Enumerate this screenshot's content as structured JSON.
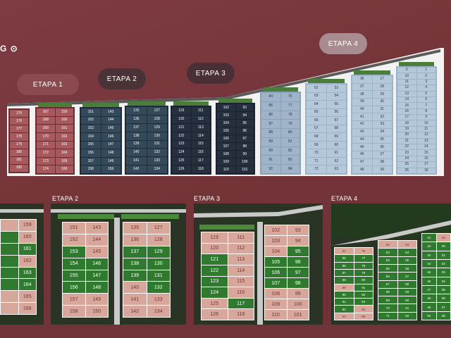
{
  "header": {
    "logo_text": "G ⊙"
  },
  "stage_buttons": [
    {
      "label": "ETAPA 1"
    },
    {
      "label": "ETAPA 2"
    },
    {
      "label": "ETAPA 3"
    },
    {
      "label": "ETAPA 4"
    }
  ],
  "master_plan": {
    "etapa1_left": [
      "175",
      "176",
      "177",
      "178",
      "179",
      "180",
      "181",
      "182"
    ],
    "etapa1_b": [
      [
        "167",
        "159"
      ],
      [
        "168",
        "160"
      ],
      [
        "169",
        "161"
      ],
      [
        "170",
        "162"
      ],
      [
        "171",
        "163"
      ],
      [
        "172",
        "164"
      ],
      [
        "173",
        "165"
      ],
      [
        "174",
        "166"
      ]
    ],
    "etapa2_a": [
      [
        "151",
        "143"
      ],
      [
        "152",
        "144"
      ],
      [
        "153",
        "145"
      ],
      [
        "154",
        "146"
      ],
      [
        "155",
        "147"
      ],
      [
        "156",
        "148"
      ],
      [
        "157",
        "149"
      ],
      [
        "158",
        "150"
      ]
    ],
    "etapa2_b": [
      [
        "135",
        "127"
      ],
      [
        "136",
        "128"
      ],
      [
        "137",
        "129"
      ],
      [
        "138",
        "130"
      ],
      [
        "139",
        "131"
      ],
      [
        "140",
        "132"
      ],
      [
        "141",
        "133"
      ],
      [
        "142",
        "134"
      ]
    ],
    "etapa3_a": [
      [
        "119",
        "111"
      ],
      [
        "120",
        "112"
      ],
      [
        "121",
        "113"
      ],
      [
        "122",
        "114"
      ],
      [
        "123",
        "115"
      ],
      [
        "124",
        "116"
      ],
      [
        "125",
        "117"
      ],
      [
        "126",
        "118"
      ]
    ],
    "etapa3_b": [
      [
        "102",
        "93"
      ],
      [
        "103",
        "94"
      ],
      [
        "104",
        "95"
      ],
      [
        "105",
        "96"
      ],
      [
        "106",
        "97"
      ],
      [
        "107",
        "98"
      ],
      [
        "108",
        "99"
      ],
      [
        "109",
        "100"
      ],
      [
        "110",
        "101"
      ]
    ],
    "etapa4_a": [
      [
        "84",
        "76"
      ],
      [
        "85",
        "77"
      ],
      [
        "86",
        "78"
      ],
      [
        "87",
        "79"
      ],
      [
        "88",
        "80"
      ],
      [
        "89",
        "81"
      ],
      [
        "90",
        "82"
      ],
      [
        "91",
        "83"
      ],
      [
        "92",
        "84"
      ]
    ],
    "etapa4_b": [
      [
        "62",
        "53"
      ],
      [
        "63",
        "54"
      ],
      [
        "64",
        "55"
      ],
      [
        "65",
        "56"
      ],
      [
        "66",
        "57"
      ],
      [
        "67",
        "58"
      ],
      [
        "68",
        "59"
      ],
      [
        "69",
        "60"
      ],
      [
        "70",
        "61"
      ],
      [
        "71",
        "62"
      ],
      [
        "72",
        "63"
      ]
    ],
    "etapa4_c": [
      [
        "36",
        "27"
      ],
      [
        "37",
        "28"
      ],
      [
        "38",
        "29"
      ],
      [
        "39",
        "30"
      ],
      [
        "40",
        "31"
      ],
      [
        "41",
        "32"
      ],
      [
        "42",
        "33"
      ],
      [
        "43",
        "34"
      ],
      [
        "44",
        "35"
      ],
      [
        "45",
        "36"
      ],
      [
        "46",
        "37"
      ],
      [
        "47",
        "38"
      ],
      [
        "48",
        "39"
      ]
    ],
    "etapa4_d": [
      [
        "9",
        "1"
      ],
      [
        "10",
        "2"
      ],
      [
        "11",
        "3"
      ],
      [
        "12",
        "4"
      ],
      [
        "13",
        "5"
      ],
      [
        "14",
        "6"
      ],
      [
        "15",
        "7"
      ],
      [
        "16",
        "8"
      ],
      [
        "17",
        "9"
      ],
      [
        "18",
        "10"
      ],
      [
        "19",
        "11"
      ],
      [
        "20",
        "12"
      ],
      [
        "21",
        "13"
      ],
      [
        "22",
        "14"
      ],
      [
        "23",
        "15"
      ],
      [
        "24",
        "16"
      ],
      [
        "25",
        "17"
      ],
      [
        "26",
        "18"
      ]
    ]
  },
  "panels": {
    "etapa1": {
      "label": "",
      "lots": [
        [
          "",
          "159"
        ],
        [
          "",
          "160"
        ],
        [
          "",
          "161"
        ],
        [
          "",
          "162"
        ],
        [
          "",
          "163"
        ],
        [
          "",
          "164"
        ],
        [
          "",
          "165"
        ],
        [
          "",
          "166"
        ]
      ],
      "status": [
        [
          "p",
          "p"
        ],
        [
          "g",
          "p"
        ],
        [
          "g",
          "g"
        ],
        [
          "g",
          "p"
        ],
        [
          "g",
          "g"
        ],
        [
          "g",
          "g"
        ],
        [
          "p",
          "p"
        ],
        [
          "p",
          "p"
        ]
      ]
    },
    "etapa2": {
      "label": "ETAPA 2",
      "lots_a": [
        [
          "151",
          "143"
        ],
        [
          "152",
          "144"
        ],
        [
          "153",
          "145"
        ],
        [
          "154",
          "146"
        ],
        [
          "155",
          "147"
        ],
        [
          "156",
          "148"
        ],
        [
          "157",
          "149"
        ],
        [
          "158",
          "150"
        ]
      ],
      "status_a": [
        [
          "p",
          "p"
        ],
        [
          "p",
          "p"
        ],
        [
          "g",
          "p"
        ],
        [
          "g",
          "g"
        ],
        [
          "g",
          "g"
        ],
        [
          "g",
          "g"
        ],
        [
          "p",
          "p"
        ],
        [
          "p",
          "p"
        ]
      ],
      "lots_b": [
        [
          "135",
          "127"
        ],
        [
          "136",
          "128"
        ],
        [
          "137",
          "129"
        ],
        [
          "138",
          "130"
        ],
        [
          "139",
          "131"
        ],
        [
          "140",
          "132"
        ],
        [
          "141",
          "133"
        ],
        [
          "142",
          "134"
        ]
      ],
      "status_b": [
        [
          "p",
          "p"
        ],
        [
          "p",
          "p"
        ],
        [
          "g",
          "g"
        ],
        [
          "g",
          "g"
        ],
        [
          "g",
          "g"
        ],
        [
          "p",
          "g"
        ],
        [
          "p",
          "p"
        ],
        [
          "p",
          "p"
        ]
      ]
    },
    "etapa3": {
      "label": "ETAPA 3",
      "lots_a": [
        [
          "119",
          "111"
        ],
        [
          "120",
          "112"
        ],
        [
          "121",
          "113"
        ],
        [
          "122",
          "114"
        ],
        [
          "123",
          "115"
        ],
        [
          "124",
          "116"
        ],
        [
          "125",
          "117"
        ],
        [
          "126",
          "118"
        ]
      ],
      "status_a": [
        [
          "p",
          "p"
        ],
        [
          "p",
          "p"
        ],
        [
          "g",
          "p"
        ],
        [
          "g",
          "p"
        ],
        [
          "g",
          "p"
        ],
        [
          "g",
          "p"
        ],
        [
          "p",
          "g"
        ],
        [
          "p",
          "p"
        ]
      ],
      "lots_b": [
        [
          "102",
          "93"
        ],
        [
          "103",
          "94"
        ],
        [
          "104",
          "95"
        ],
        [
          "105",
          "96"
        ],
        [
          "106",
          "97"
        ],
        [
          "107",
          "98"
        ],
        [
          "108",
          "99"
        ],
        [
          "109",
          "100"
        ],
        [
          "110",
          "101"
        ]
      ],
      "status_b": [
        [
          "p",
          "p"
        ],
        [
          "p",
          "p"
        ],
        [
          "p",
          "g"
        ],
        [
          "g",
          "g"
        ],
        [
          "g",
          "g"
        ],
        [
          "g",
          "g"
        ],
        [
          "p",
          "p"
        ],
        [
          "p",
          "p"
        ],
        [
          "p",
          "p"
        ]
      ]
    },
    "etapa4": {
      "label": "ETAPA 4",
      "lots_a": [
        [
          "84",
          "76"
        ],
        [
          "85",
          "77"
        ],
        [
          "86",
          "78"
        ],
        [
          "87",
          "79"
        ],
        [
          "88",
          "80"
        ],
        [
          "89",
          "81"
        ],
        [
          "90",
          "82"
        ],
        [
          "91",
          "83"
        ],
        [
          "92",
          "84"
        ],
        [
          "93",
          "85"
        ]
      ],
      "status_a": [
        [
          "p",
          "p"
        ],
        [
          "g",
          "g"
        ],
        [
          "g",
          "g"
        ],
        [
          "g",
          "g"
        ],
        [
          "g",
          "g"
        ],
        [
          "p",
          "g"
        ],
        [
          "g",
          "g"
        ],
        [
          "g",
          "g"
        ],
        [
          "g",
          "p"
        ],
        [
          "p",
          "p"
        ]
      ],
      "lots_b": [
        [
          "62",
          "53"
        ],
        [
          "63",
          "54"
        ],
        [
          "64",
          "55"
        ],
        [
          "65",
          "56"
        ],
        [
          "66",
          "57"
        ],
        [
          "67",
          "58"
        ],
        [
          "68",
          "59"
        ],
        [
          "69",
          "60"
        ],
        [
          "70",
          "61"
        ],
        [
          "71",
          "62"
        ]
      ],
      "status_b": [
        [
          "p",
          "p"
        ],
        [
          "g",
          "g"
        ],
        [
          "g",
          "g"
        ],
        [
          "g",
          "g"
        ],
        [
          "g",
          "g"
        ],
        [
          "g",
          "g"
        ],
        [
          "g",
          "g"
        ],
        [
          "g",
          "g"
        ],
        [
          "g",
          "g"
        ],
        [
          "g",
          "g"
        ]
      ],
      "lots_c": [
        [
          "41",
          "29"
        ],
        [
          "42",
          "30"
        ],
        [
          "43",
          "31"
        ],
        [
          "44",
          "32"
        ],
        [
          "45",
          "33"
        ],
        [
          "46",
          "34"
        ],
        [
          "47",
          "35"
        ],
        [
          "48",
          "36"
        ],
        [
          "49",
          "37"
        ],
        [
          "50",
          "38"
        ]
      ],
      "status_c": [
        [
          "g",
          "p"
        ],
        [
          "g",
          "g"
        ],
        [
          "g",
          "g"
        ],
        [
          "g",
          "g"
        ],
        [
          "g",
          "g"
        ],
        [
          "g",
          "g"
        ],
        [
          "g",
          "g"
        ],
        [
          "g",
          "g"
        ],
        [
          "g",
          "g"
        ],
        [
          "g",
          "g"
        ]
      ]
    }
  },
  "colors": {
    "background": "#7a3a3f",
    "available": "#d6a79a",
    "sold": "#2f7a2f"
  }
}
